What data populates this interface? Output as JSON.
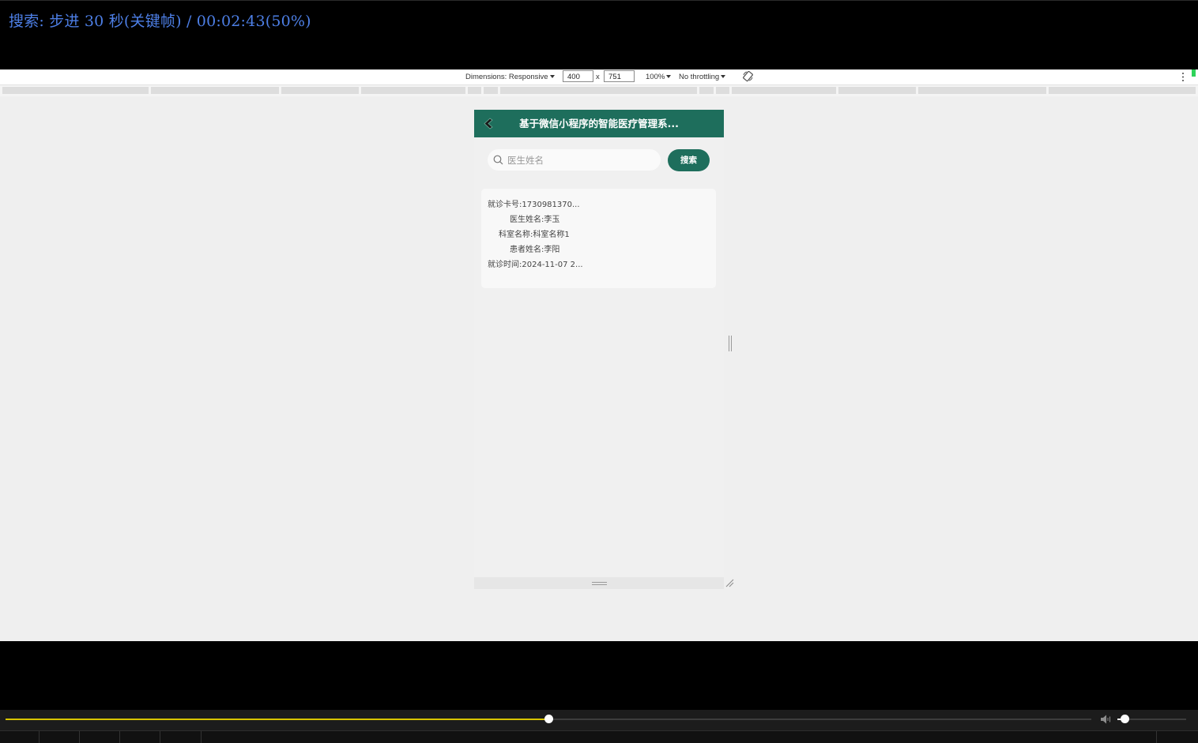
{
  "osd": {
    "text": "搜索: 步进 30 秒(关键帧) / 00:02:43(50%)"
  },
  "devtools": {
    "dimensions_label": "Dimensions: Responsive",
    "width": "400",
    "times": "x",
    "height": "751",
    "zoom": "100%",
    "throttling": "No throttling",
    "rotate_icon": "rotate-icon",
    "more_icon": "kebab-menu-icon"
  },
  "app": {
    "title": "基于微信小程序的智能医疗管理系...",
    "back_icon": "back-icon",
    "header_color": "#1e6e5c",
    "search": {
      "placeholder": "医生姓名",
      "button": "搜索",
      "icon": "search-icon"
    },
    "records": [
      {
        "card_no": "就诊卡号:1730981370...",
        "doctor": "医生姓名:李玉",
        "department": "科室名称:科室名称1",
        "patient": "患者姓名:李阳",
        "visit_time": "就诊时间:2024-11-07 2..."
      }
    ]
  },
  "player": {
    "progress": 0.5,
    "volume": 0.1,
    "accent_color": "#d8c400",
    "volume_icon": "speaker-icon"
  }
}
